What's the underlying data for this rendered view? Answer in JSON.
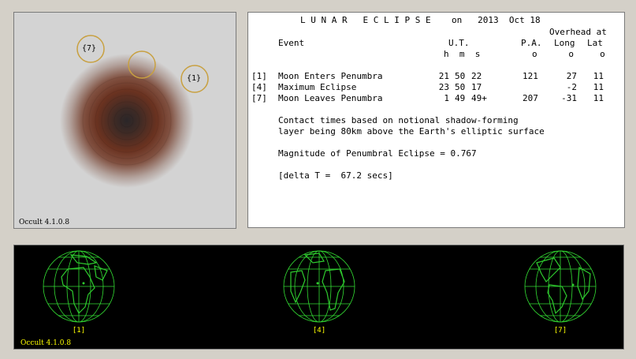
{
  "diagram": {
    "markers": {
      "m7": "{7}",
      "m1": "{1}"
    },
    "version": "Occult 4.1.0.8"
  },
  "report": {
    "title": "L U N A R   E C L I P S E    on   2013  Oct 18",
    "overhead_header": "Overhead at",
    "col_event": "Event",
    "col_ut": "U.T.",
    "col_pa": "P.A.",
    "col_long": "Long",
    "col_lat": "Lat",
    "units_hms": "h  m  s",
    "units_deg": "o      o     o",
    "events": [
      {
        "code": "[1]",
        "name": "Moon Enters Penumbra",
        "h": "21",
        "m": "50",
        "s": "22",
        "pa": "121",
        "long": "27",
        "lat": "11"
      },
      {
        "code": "[4]",
        "name": "Maximum Eclipse",
        "h": "23",
        "m": "50",
        "s": "17",
        "pa": "",
        "long": "-2",
        "lat": "11"
      },
      {
        "code": "[7]",
        "name": "Moon Leaves Penumbra",
        "h": "1",
        "m": "49",
        "s": "49+",
        "pa": "207",
        "long": "-31",
        "lat": "11"
      }
    ],
    "note_line1": "Contact times based on notional shadow-forming",
    "note_line2": "layer being 80km above the Earth's elliptic surface",
    "magnitude": "Magnitude of Penumbral Eclipse = 0.767",
    "delta_t": "[delta T =  67.2 secs]"
  },
  "earths": {
    "labels": [
      "[1]",
      "[4]",
      "[7]"
    ],
    "version": "Occult 4.1.0.8"
  },
  "colors": {
    "grid": "#33dd33",
    "land": "#2ecc2e",
    "label": "#ffff00",
    "marker": "#c8a040"
  }
}
